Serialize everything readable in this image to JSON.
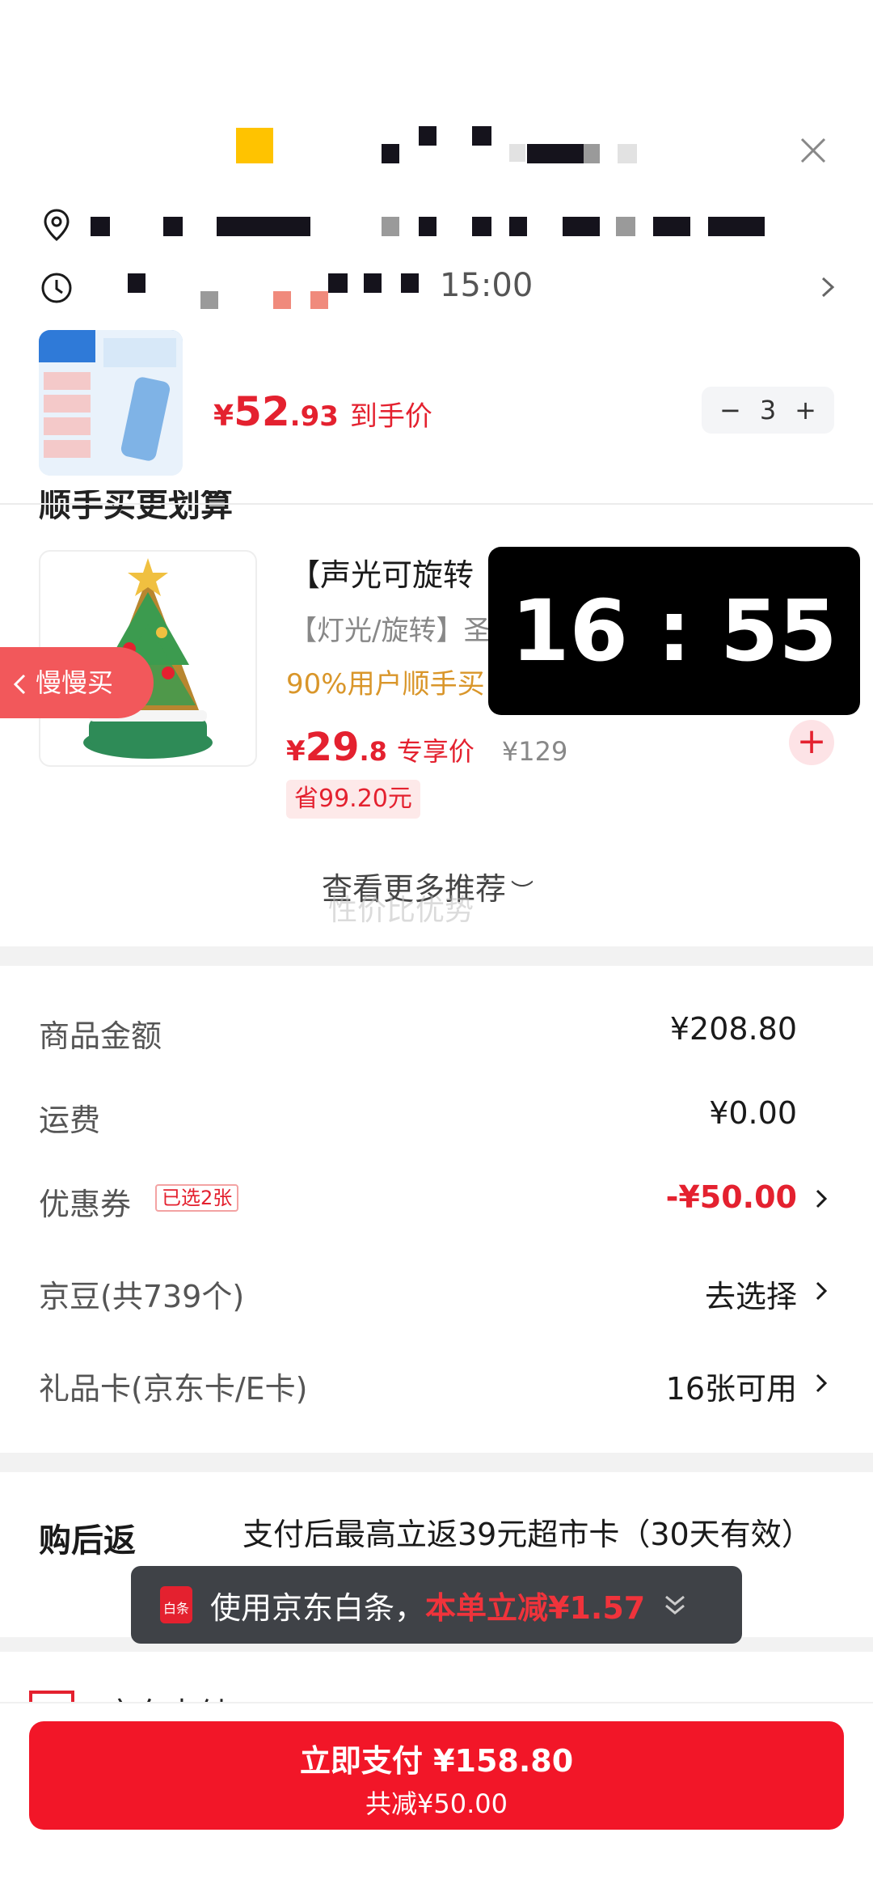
{
  "header": {
    "time_partial": "15:00"
  },
  "product": {
    "price_yen": "¥",
    "price_int": "52",
    "price_dec": ".93",
    "price_label": "到手价",
    "quantity": "3",
    "minus": "−",
    "plus": "+"
  },
  "recommend": {
    "section_title": "顺手买更划算",
    "item": {
      "name": "【声光可旋转",
      "subtitle": "【灯光/旋转】圣",
      "user_pct": "90%用户顺手买",
      "price_yen": "¥",
      "price_int": "29",
      "price_dec": ".8",
      "price_label": "专享价",
      "original_price": "¥129",
      "save": "省99.20元"
    },
    "slow_buy": "慢慢买",
    "more": "查看更多推荐",
    "watermark": "性价比优势"
  },
  "timer": "16 : 55",
  "summary": {
    "goods_amount_label": "商品金额",
    "goods_amount_value": "¥208.80",
    "shipping_label": "运费",
    "shipping_value": "¥0.00",
    "coupon_label": "优惠券",
    "coupon_tag": "已选2张",
    "coupon_value": "-¥50.00",
    "beans_label": "京豆(共739个)",
    "beans_value": "去选择",
    "giftcard_label": "礼品卡(京东卡/E卡)",
    "giftcard_value": "16张可用"
  },
  "rebate": {
    "label": "购后返",
    "text": "支付后最高立返39元超市卡（30天有效）"
  },
  "baitiao": {
    "icon_text": "白条",
    "text": "使用京东白条，",
    "highlight": "本单立减¥1.57"
  },
  "pay": {
    "peek_text": "京东支付",
    "main": "立即支付 ¥158.80",
    "sub": "共减¥50.00"
  },
  "colors": {
    "accent_red": "#e4212f",
    "pay_red": "#f21628",
    "gold": "#d9962a"
  }
}
